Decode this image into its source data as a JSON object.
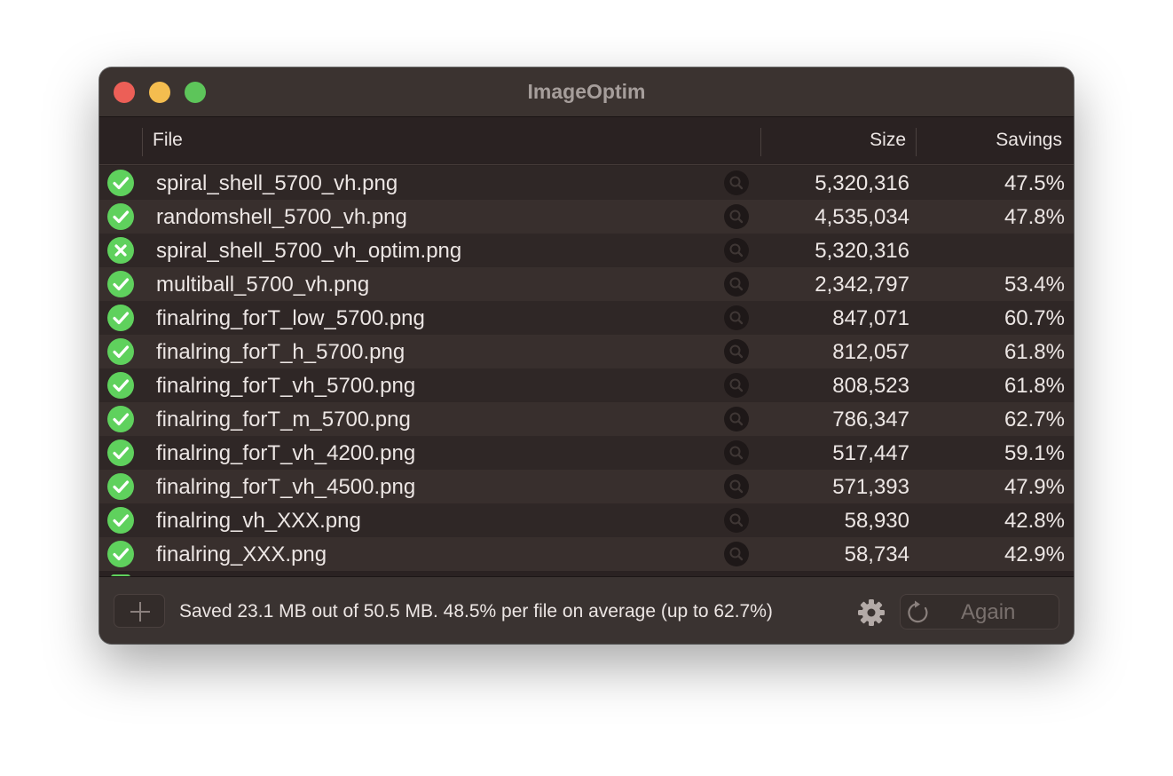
{
  "window": {
    "title": "ImageOptim"
  },
  "columns": {
    "file": "File",
    "size": "Size",
    "savings": "Savings"
  },
  "files": [
    {
      "status": "success",
      "name": "spiral_shell_5700_vh.png",
      "size": "5,320,316",
      "savings": "47.5%"
    },
    {
      "status": "success",
      "name": "randomshell_5700_vh.png",
      "size": "4,535,034",
      "savings": "47.8%"
    },
    {
      "status": "failed",
      "name": "spiral_shell_5700_vh_optim.png",
      "size": "5,320,316",
      "savings": ""
    },
    {
      "status": "success",
      "name": "multiball_5700_vh.png",
      "size": "2,342,797",
      "savings": "53.4%"
    },
    {
      "status": "success",
      "name": "finalring_forT_low_5700.png",
      "size": "847,071",
      "savings": "60.7%"
    },
    {
      "status": "success",
      "name": "finalring_forT_h_5700.png",
      "size": "812,057",
      "savings": "61.8%"
    },
    {
      "status": "success",
      "name": "finalring_forT_vh_5700.png",
      "size": "808,523",
      "savings": "61.8%"
    },
    {
      "status": "success",
      "name": "finalring_forT_m_5700.png",
      "size": "786,347",
      "savings": "62.7%"
    },
    {
      "status": "success",
      "name": "finalring_forT_vh_4200.png",
      "size": "517,447",
      "savings": "59.1%"
    },
    {
      "status": "success",
      "name": "finalring_forT_vh_4500.png",
      "size": "571,393",
      "savings": "47.9%"
    },
    {
      "status": "success",
      "name": "finalring_vh_XXX.png",
      "size": "58,930",
      "savings": "42.8%"
    },
    {
      "status": "success",
      "name": "finalring_XXX.png",
      "size": "58,734",
      "savings": "42.9%"
    }
  ],
  "footer": {
    "summary": "Saved 23.1 MB out of 50.5 MB. 48.5% per file on average (up to 62.7%)",
    "again_label": "Again"
  },
  "icons": {
    "add": "plus-icon",
    "settings": "gear-icon",
    "again": "refresh-icon",
    "success": "checkmark-icon",
    "failed": "x-icon",
    "preview": "magnifier-icon"
  },
  "colors": {
    "success_green": "#5fd15d",
    "close_red": "#ec5f57",
    "minimize_yellow": "#f4bd4f",
    "maximize_green": "#5dc55a"
  }
}
